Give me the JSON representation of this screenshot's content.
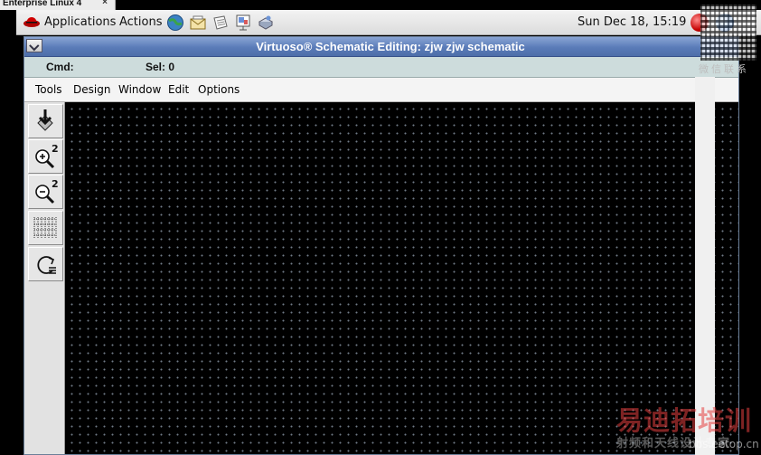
{
  "host_tab": {
    "title": "Enterprise Linux 4",
    "close_glyph": "×"
  },
  "panel": {
    "applications_label": "Applications",
    "actions_label": "Actions",
    "clock": "Sun Dec 18, 15:19",
    "launchers": [
      "web-browser-icon",
      "email-icon",
      "text-editor-icon",
      "presentation-icon",
      "print-manager-icon"
    ],
    "tray": [
      "update-notifier-icon",
      "network-globe-icon"
    ]
  },
  "watermark": {
    "qr_caption": "微信联系",
    "site_name": "易迪拓培训",
    "site_subtitle": "射频和天线设计专家",
    "url": "bbs.eetop.cn"
  },
  "window": {
    "title": "Virtuoso® Schematic Editing: zjw zjw schematic",
    "status": {
      "cmd_label": "Cmd:",
      "sel_label": "Sel: 0"
    },
    "menus": [
      "Tools",
      "Design",
      "Window",
      "Edit",
      "Options"
    ],
    "tools": [
      {
        "name": "save-check-icon"
      },
      {
        "name": "zoom-in-2x-icon",
        "badge": "2"
      },
      {
        "name": "zoom-out-2x-icon",
        "badge": "2"
      },
      {
        "name": "grid-pattern-icon"
      },
      {
        "name": "redraw-icon"
      }
    ]
  },
  "colors": {
    "panel_bg": "#e3e3e3",
    "titlebar": "#5a7bb8",
    "statusbar": "#cddcdc",
    "canvas": "#000000",
    "grid_dot": "#6f7a86"
  }
}
